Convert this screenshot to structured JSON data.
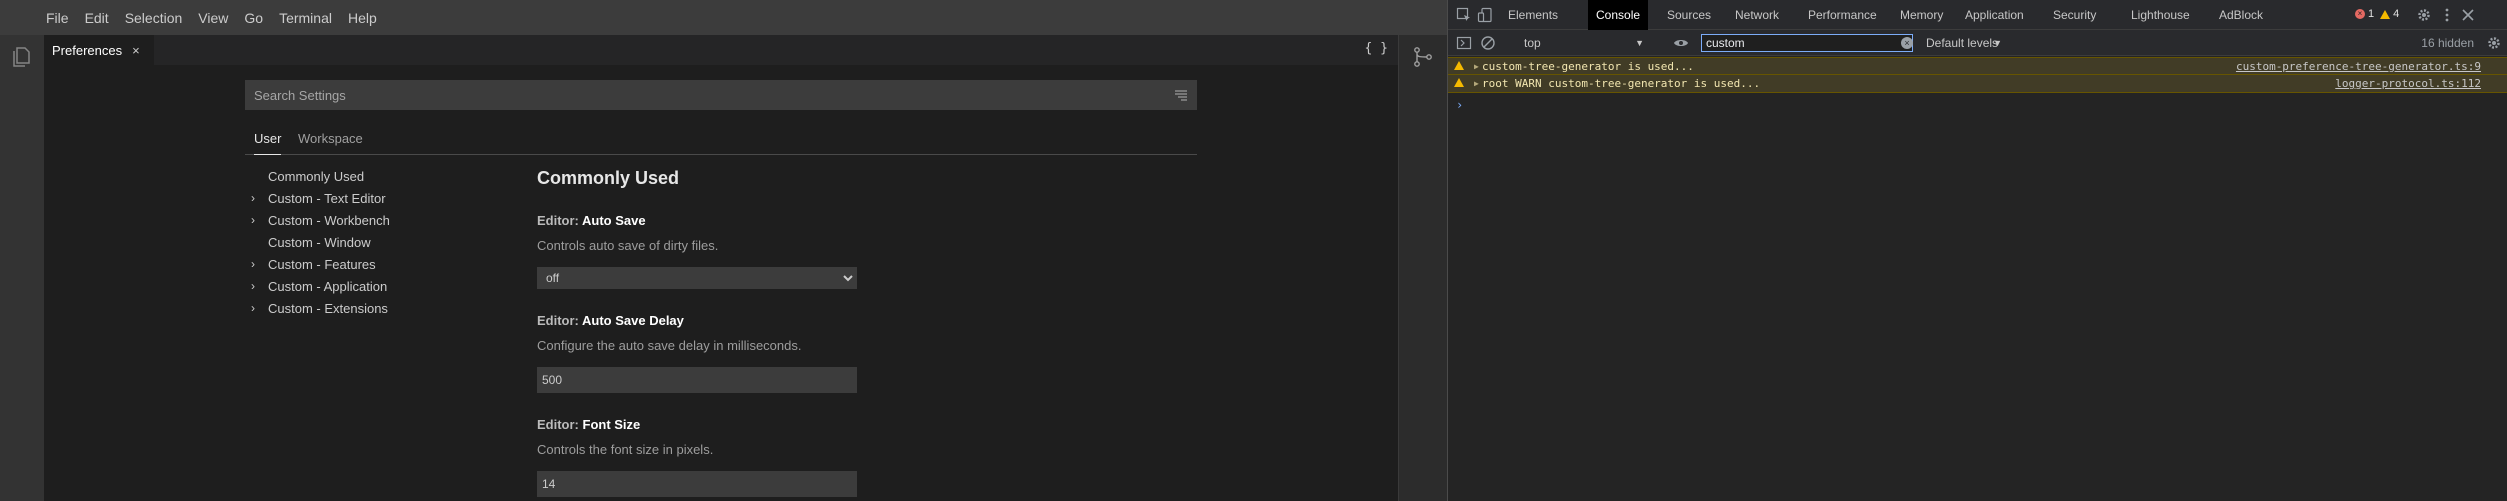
{
  "menubar": {
    "items": [
      "File",
      "Edit",
      "Selection",
      "View",
      "Go",
      "Terminal",
      "Help"
    ]
  },
  "activity": {
    "icon": "explorer-icon"
  },
  "editor_tab": {
    "title": "Preferences",
    "close": "×",
    "json_toggle": "{ }"
  },
  "settings": {
    "search_placeholder": "Search Settings",
    "scope_tabs": {
      "user": "User",
      "workspace": "Workspace"
    },
    "toc": [
      {
        "label": "Commonly Used",
        "expandable": false
      },
      {
        "label": "Custom - Text Editor",
        "expandable": true
      },
      {
        "label": "Custom - Workbench",
        "expandable": true
      },
      {
        "label": "Custom - Window",
        "expandable": false
      },
      {
        "label": "Custom - Features",
        "expandable": true
      },
      {
        "label": "Custom - Application",
        "expandable": true
      },
      {
        "label": "Custom - Extensions",
        "expandable": true
      }
    ],
    "heading": "Commonly Used",
    "items": [
      {
        "category": "Editor: ",
        "name": "Auto Save",
        "description": "Controls auto save of dirty files.",
        "value": "off"
      },
      {
        "category": "Editor: ",
        "name": "Auto Save Delay",
        "description": "Configure the auto save delay in milliseconds.",
        "value": "500"
      },
      {
        "category": "Editor: ",
        "name": "Font Size",
        "description": "Controls the font size in pixels.",
        "value": "14"
      }
    ]
  },
  "devtools": {
    "tabs": [
      "Elements",
      "Console",
      "Sources",
      "Network",
      "Performance",
      "Memory",
      "Application",
      "Security",
      "Lighthouse",
      "AdBlock"
    ],
    "active_tab": "Console",
    "error_count": "1",
    "warning_count": "4",
    "context": "top",
    "filter_value": "custom",
    "levels": "Default levels",
    "hidden": "16 hidden",
    "messages": [
      {
        "text": "custom-tree-generator is used...",
        "source": "custom-preference-tree-generator.ts:9"
      },
      {
        "text": "root WARN custom-tree-generator is used...",
        "source": "logger-protocol.ts:112"
      }
    ],
    "colors": {
      "warning_bg": "#413c26",
      "warning_icon": "#f5ba00",
      "error": "#e46962"
    }
  }
}
